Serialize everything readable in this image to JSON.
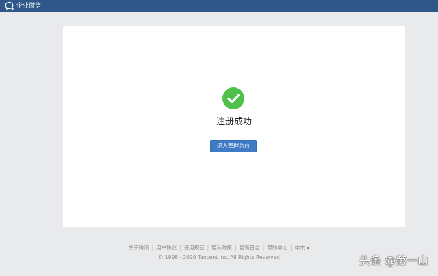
{
  "header": {
    "brand_name": "企业微信",
    "logo_icon": "wecom-chat-bubble-icon"
  },
  "main": {
    "status_icon": "success-check-icon",
    "title": "注册成功",
    "enter_admin_button": "进入管理后台"
  },
  "footer": {
    "links": [
      "关于腾讯",
      "用户协议",
      "使用规范",
      "隐私政策",
      "更新日志",
      "帮助中心"
    ],
    "language": "中文",
    "copyright": "© 1998 - 2020 Tencent Inc. All Rights Reserved"
  },
  "watermark": "头条 @第一山",
  "colors": {
    "topbar": "#2f5789",
    "background": "#e9eaec",
    "success": "#4fc04a",
    "button": "#3e7bc4"
  }
}
